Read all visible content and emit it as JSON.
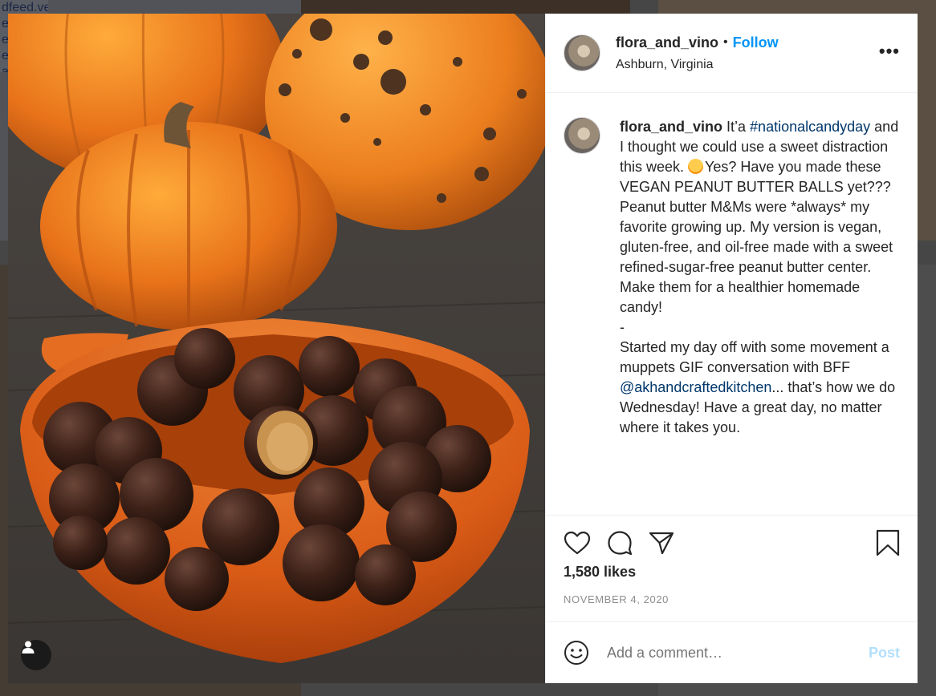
{
  "background": {
    "snippet": [
      "dfeed.vegan/",
      "ec",
      "ec",
      "ec",
      "a"
    ]
  },
  "post": {
    "username": "flora_and_vino",
    "follow_label": "Follow",
    "separator": "•",
    "location": "Ashburn, Virginia",
    "more_label": "•••",
    "caption": {
      "username": "flora_and_vino",
      "part1": " It’a ",
      "hashtag": "#nationalcandyday",
      "part2": " and I thought we could use a sweet distraction this week. ",
      "part3": "Yes? Have you made these VEGAN PEANUT BUTTER BALLS yet??? Peanut butter M&Ms were *always* my favorite growing up. My version is vegan, gluten-free, and oil-free made with a sweet refined-sugar-free peanut butter center. Make them for a healthier homemade candy!",
      "dash": "-",
      "part4": "Started my day off with some movement a muppets GIF conversation with BFF ",
      "mention": "@akhandcraftedkitchen",
      "part5": "... that’s how we do Wednesday! Have a great day, no matter where it takes you."
    },
    "likes": "1,580 likes",
    "date": "NOVEMBER 4, 2020",
    "comment_placeholder": "Add a comment…",
    "post_label": "Post"
  },
  "icons": {
    "like": "heart-icon",
    "comment": "comment-icon",
    "share": "paper-plane-icon",
    "save": "bookmark-icon",
    "emoji": "smiley-icon",
    "user_tag": "user-icon"
  },
  "colors": {
    "link": "#0095f6",
    "hashtag": "#00376b",
    "muted": "#8e8e8e",
    "post_disabled": "#b2dffc"
  }
}
